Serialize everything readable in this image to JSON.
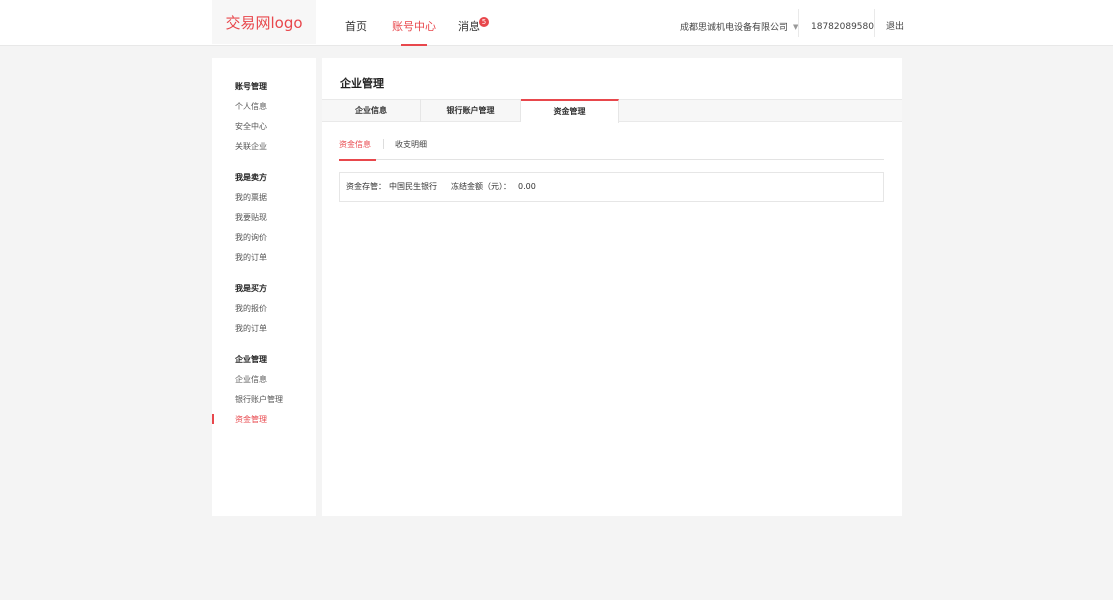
{
  "header": {
    "logo_text": "交易网logo",
    "nav": [
      {
        "label": "首页",
        "active": false
      },
      {
        "label": "账号中心",
        "active": true
      },
      {
        "label": "消息",
        "active": false,
        "badge": "5"
      }
    ],
    "company": "成都思诚机电设备有限公司",
    "caret_icon": "chevron-down-icon",
    "phone": "18782089580",
    "logout": "退出"
  },
  "sidebar": {
    "groups": [
      {
        "title": "账号管理",
        "items": [
          "个人信息",
          "安全中心",
          "关联企业"
        ]
      },
      {
        "title": "我是卖方",
        "items": [
          "我的票据",
          "我要贴现",
          "我的询价",
          "我的订单"
        ]
      },
      {
        "title": "我是买方",
        "items": [
          "我的报价",
          "我的订单"
        ]
      },
      {
        "title": "企业管理",
        "items": [
          "企业信息",
          "银行账户管理",
          "资金管理"
        ]
      }
    ],
    "active_item": "资金管理"
  },
  "main": {
    "title": "企业管理",
    "tabs": [
      {
        "label": "企业信息",
        "active": false
      },
      {
        "label": "银行账户管理",
        "active": false
      },
      {
        "label": "资金管理",
        "active": true
      }
    ],
    "subtabs": [
      {
        "label": "资金信息",
        "active": true
      },
      {
        "label": "收支明细",
        "active": false
      }
    ],
    "info": {
      "custody_label": "资金存管：",
      "custody_bank": "中国民生银行",
      "frozen_label": "冻结金额（元）：",
      "frozen_value": "0.00"
    }
  },
  "colors": {
    "accent": "#e8474c",
    "background": "#f4f4f4"
  }
}
